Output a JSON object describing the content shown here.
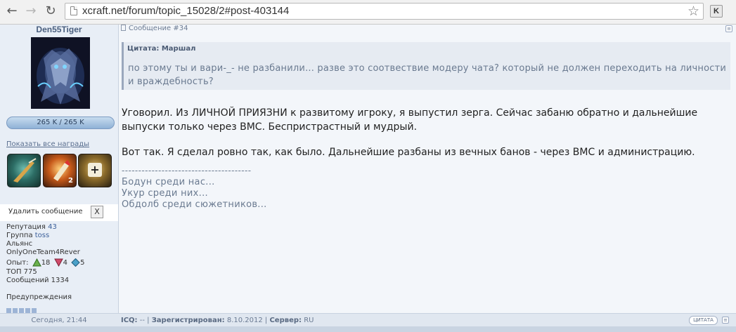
{
  "browser": {
    "url": "xcraft.net/forum/topic_15028/2#post-403144",
    "extension_label": "K"
  },
  "post": {
    "author": "Den55Tiger",
    "hp": "265 K / 265 K",
    "show_awards": "Показать все награды",
    "awards": [
      {
        "name": "award-rifle"
      },
      {
        "name": "award-rocket",
        "count": "2"
      },
      {
        "name": "award-gold-plus"
      }
    ],
    "delete_label": "Удалить сообщение",
    "delete_x": "X",
    "reputation_label": "Репутация",
    "reputation": "43",
    "group_label": "Группа",
    "group": "toss",
    "alliance_label": "Альянс",
    "alliance": "OnlyOneTeam4Rever",
    "exp_label": "Опыт:",
    "exp": [
      "18",
      "4",
      "5"
    ],
    "top": "ТОП 775",
    "messages": "Сообщений 1334",
    "warnings_label": "Предупреждения",
    "post_number": "Сообщение #34",
    "quote_title": "Цитата: Маршал",
    "quote_text": "по этому ты и вари-_- не разбанили... разве это соотвествие модеру чата? который не должен переходить на личности и враждебность?",
    "paragraph1": "Уговорил. Из ЛИЧНОЙ ПРИЯЗНИ к развитому игроку, я выпустил зерга. Сейчас забаню обратно и дальнейшие выпуски только через ВМС. Беспристрастный и мудрый.",
    "paragraph2": "Вот так. Я сделал ровно так, как было. Дальнейшие разбаны из вечных банов - через ВМС и администрацию.",
    "divider": "---------------------------------------",
    "signature": [
      "Бодун среди нас...",
      "Укур среди них...",
      "Обдолб среди сюжетников..."
    ],
    "time": "Сегодня, 21:44",
    "footer_icq_label": "ICQ:",
    "footer_icq": "--",
    "footer_reg_label": "Зарегистрирован:",
    "footer_reg": "8.10.2012",
    "footer_server_label": "Сервер:",
    "footer_server": "RU",
    "quote_button": "ЦИТАТА"
  },
  "colors": {
    "sidebar_bg": "#e8eef6",
    "quote_bg": "#e6ebf2",
    "link": "#3b5f9a"
  }
}
